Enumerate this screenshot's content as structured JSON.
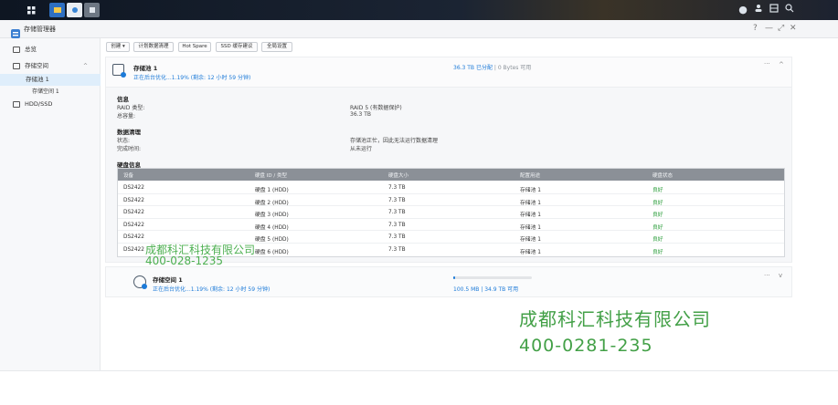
{
  "window": {
    "app_title": "存储管理器",
    "controls": {
      "help": "?",
      "minimize": "—",
      "maximize": "⤢",
      "close": "✕"
    }
  },
  "taskbar": {
    "left_icons": [
      "grid-icon",
      "file-station-icon",
      "photo-icon",
      "app-icon"
    ],
    "right_icons": [
      "chat-icon",
      "user-icon",
      "widgets-icon",
      "search-icon"
    ]
  },
  "sidebar": {
    "items": [
      {
        "label": "总览",
        "icon": "overview-icon"
      },
      {
        "label": "存储空间",
        "icon": "storage-icon",
        "expanded": true
      },
      {
        "label": "存储池 1",
        "selected": true
      },
      {
        "label": "存储空间 1"
      },
      {
        "label": "HDD/SSD",
        "icon": "disk-icon"
      }
    ]
  },
  "toolbar": {
    "buttons": [
      "创建 ▾",
      "计划数据清理",
      "Hot Spare",
      "SSD 缓存建议",
      "全局设置"
    ]
  },
  "pool1": {
    "name": "存储池 1",
    "status": "正在后台优化...1.19% (剩余: 12 小时 59 分钟)",
    "capacity_used": "36.3 TB 已分配",
    "capacity_free": "| 0 Bytes 可用",
    "more": "···",
    "collapse": "^",
    "info": {
      "title": "信息",
      "raid_label": "RAID 类型:",
      "raid_value": "RAID 5 (有数据保护)",
      "cap_label": "总容量:",
      "cap_value": "36.3 TB"
    },
    "scrub": {
      "title": "数据清理",
      "status_label": "状态:",
      "status_value": "存储池正忙，因此无法运行数据清理",
      "last_label": "完成时间:",
      "last_value": "从未运行"
    },
    "disk_info_title": "硬盘信息",
    "table": {
      "headers": [
        "设备",
        "硬盘 ID / 类型",
        "硬盘大小",
        "配置用途",
        "硬盘状态"
      ],
      "rows": [
        [
          "DS2422",
          "硬盘 1 (HDD)",
          "7.3 TB",
          "存储池 1",
          "良好"
        ],
        [
          "DS2422",
          "硬盘 2 (HDD)",
          "7.3 TB",
          "存储池 1",
          "良好"
        ],
        [
          "DS2422",
          "硬盘 3 (HDD)",
          "7.3 TB",
          "存储池 1",
          "良好"
        ],
        [
          "DS2422",
          "硬盘 4 (HDD)",
          "7.3 TB",
          "存储池 1",
          "良好"
        ],
        [
          "DS2422",
          "硬盘 5 (HDD)",
          "7.3 TB",
          "存储池 1",
          "良好"
        ],
        [
          "DS2422",
          "硬盘 6 (HDD)",
          "7.3 TB",
          "存储池 1",
          "良好"
        ]
      ]
    }
  },
  "volume1": {
    "name": "存储空间 1",
    "status": "正在后台优化...1.19% (剩余: 12 小时 59 分钟)",
    "capacity": "100.5 MB | 34.9 TB 可用",
    "progress": 0.01,
    "more": "···",
    "expand": "v"
  },
  "watermark": {
    "small_company": "成都科汇科技有限公司",
    "small_phone": "400-028-1235",
    "big_company": "成都科汇科技有限公司",
    "big_phone": "400-0281-235"
  },
  "colors": {
    "accent": "#1c7ad8",
    "good": "#2a9d3a",
    "watermark": "#43a047"
  }
}
